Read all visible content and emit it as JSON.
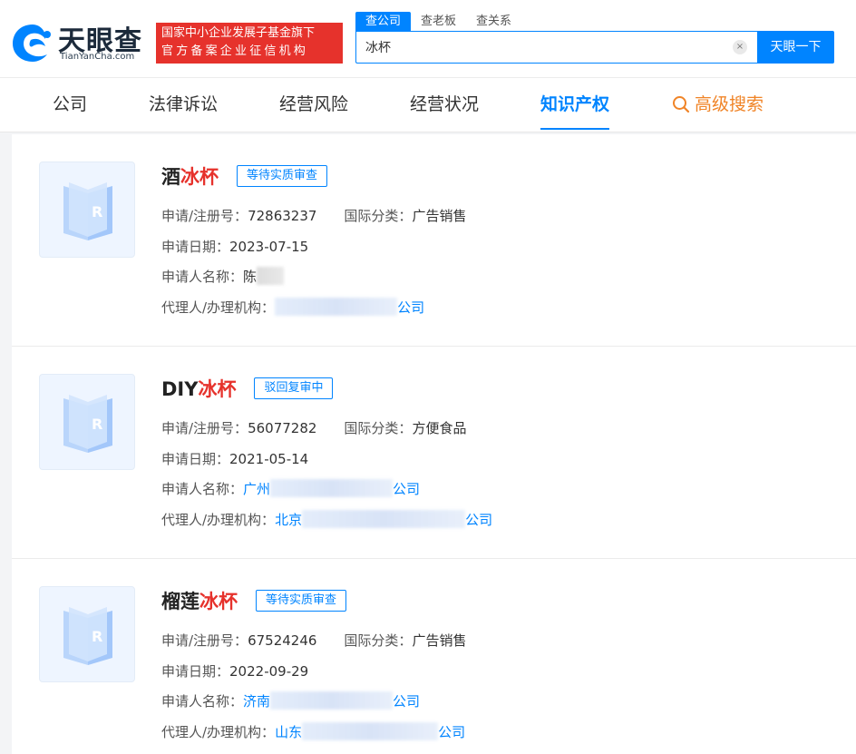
{
  "header": {
    "logo_cn": "天眼查",
    "logo_en": "TianYanCha.com",
    "badge_line1": "国家中小企业发展子基金旗下",
    "badge_line2": "官方备案企业征信机构",
    "search_tabs": [
      "查公司",
      "查老板",
      "查关系"
    ],
    "search_value": "冰杯",
    "search_button": "天眼一下",
    "clear_symbol": "×"
  },
  "nav": {
    "items": [
      "公司",
      "法律诉讼",
      "经营风险",
      "经营状况",
      "知识产权"
    ],
    "active": "知识产权",
    "advanced": "高级搜索"
  },
  "labels": {
    "reg_no": "申请/注册号：",
    "intl_class": "国际分类：",
    "apply_date": "申请日期：",
    "applicant": "申请人名称：",
    "agent": "代理人/办理机构："
  },
  "results": [
    {
      "title_prefix": "酒",
      "title_highlight": "冰杯",
      "status": "等待实质审查",
      "reg_no": "72863237",
      "intl_class": "广告销售",
      "apply_date": "2023-07-15",
      "applicant_prefix": "陈",
      "applicant_suffix": "",
      "agent_prefix": "",
      "agent_suffix": "公司"
    },
    {
      "title_prefix": "DIY",
      "title_highlight": "冰杯",
      "status": "驳回复审中",
      "reg_no": "56077282",
      "intl_class": "方便食品",
      "apply_date": "2021-05-14",
      "applicant_prefix": "广州",
      "applicant_suffix": "公司",
      "agent_prefix": "北京",
      "agent_suffix": "公司"
    },
    {
      "title_prefix": "榴莲",
      "title_highlight": "冰杯",
      "status": "等待实质审查",
      "reg_no": "67524246",
      "intl_class": "广告销售",
      "apply_date": "2022-09-29",
      "applicant_prefix": "济南",
      "applicant_suffix": "公司",
      "agent_prefix": "山东",
      "agent_suffix": "公司"
    }
  ]
}
